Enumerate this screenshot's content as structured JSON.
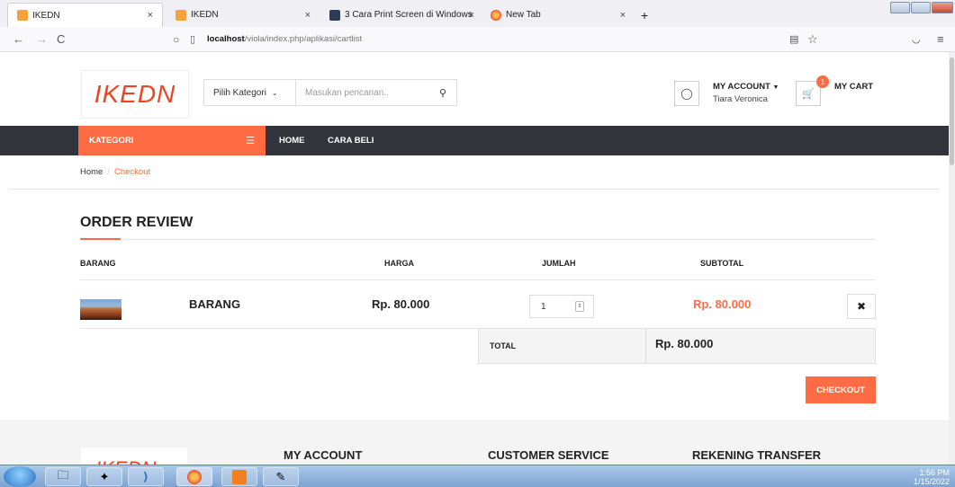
{
  "browser": {
    "tabs": [
      {
        "label": "IKEDN",
        "close": "×"
      },
      {
        "label": "IKEDN",
        "close": "×"
      },
      {
        "label": "3 Cara Print Screen di Windows",
        "close": "×"
      },
      {
        "label": "New Tab",
        "close": "×"
      }
    ],
    "new_tab": "+",
    "url_host": "localhost",
    "url_path": "/viola/index.php/aplikasi/cartlist"
  },
  "header": {
    "logo": "IKEDN",
    "category_select": "Pilih Kategori",
    "search_placeholder": "Masukan pencarian..",
    "account_title": "MY ACCOUNT",
    "account_user": "Tiara Veronica",
    "cart_title": "MY CART",
    "cart_count": "1"
  },
  "nav": {
    "kategori": "KATEGORI",
    "items": [
      "HOME",
      "CARA BELI"
    ]
  },
  "breadcrumb": {
    "home": "Home",
    "sep": "/",
    "current": "Checkout"
  },
  "order": {
    "title": "ORDER REVIEW",
    "columns": [
      "BARANG",
      "HARGA",
      "JUMLAH",
      "SUBTOTAL"
    ],
    "rows": [
      {
        "name": "BARANG",
        "price": "Rp. 80.000",
        "qty": "1",
        "subtotal": "Rp. 80.000"
      }
    ],
    "total_label": "TOTAL",
    "total_value": "Rp. 80.000",
    "checkout_label": "CHECKOUT"
  },
  "footer": {
    "headings": [
      "MY ACCOUNT",
      "CUSTOMER SERVICE",
      "REKENING TRANSFER"
    ]
  },
  "taskbar": {
    "time": "1:56 PM",
    "date": "1/15/2022"
  },
  "colors": {
    "accent": "#ff6b42",
    "dark_bar": "#31343a"
  }
}
